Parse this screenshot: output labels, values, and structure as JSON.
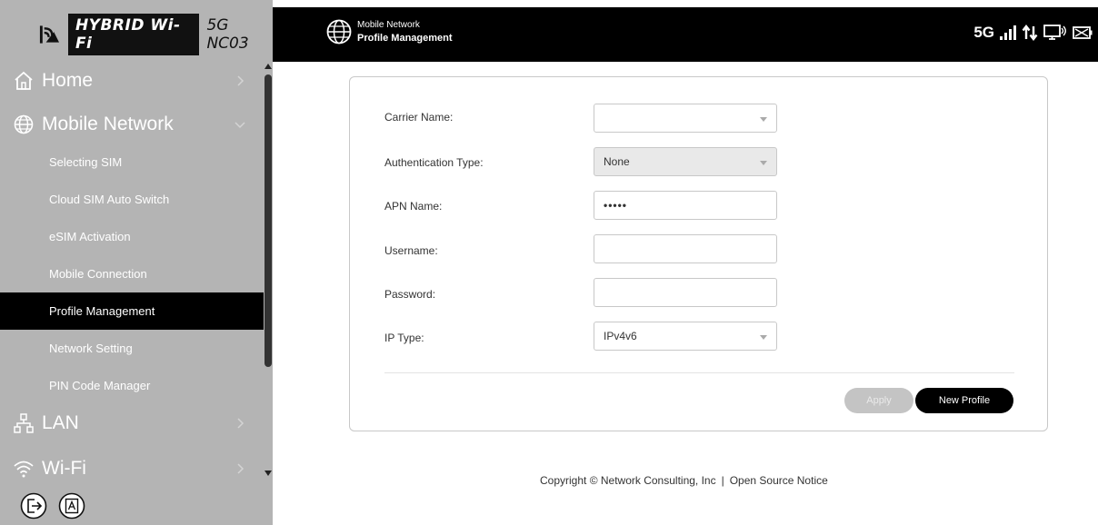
{
  "brand": {
    "logo_text": "HYBRID Wi-Fi",
    "model": "5G NC03"
  },
  "header": {
    "parent": "Mobile Network",
    "title": "Profile Management",
    "network": "5G"
  },
  "sidebar": {
    "items": [
      {
        "label": "Home"
      },
      {
        "label": "Mobile Network"
      },
      {
        "label": "Selecting SIM"
      },
      {
        "label": "Cloud SIM Auto Switch"
      },
      {
        "label": "eSIM Activation"
      },
      {
        "label": "Mobile Connection"
      },
      {
        "label": "Profile Management"
      },
      {
        "label": "Network Setting"
      },
      {
        "label": "PIN Code Manager"
      },
      {
        "label": "LAN"
      },
      {
        "label": "Wi-Fi"
      }
    ]
  },
  "form": {
    "carrier_label": "Carrier Name:",
    "carrier_value": "",
    "auth_label": "Authentication Type:",
    "auth_value": "None",
    "apn_label": "APN Name:",
    "apn_value": "•••••",
    "username_label": "Username:",
    "username_value": "",
    "password_label": "Password:",
    "password_value": "",
    "ip_label": "IP Type:",
    "ip_value": "IPv4v6",
    "apply_label": "Apply",
    "new_profile_label": "New Profile"
  },
  "footer": {
    "copyright": "Copyright © Network Consulting, Inc",
    "separator": "|",
    "open_source": "Open Source Notice"
  },
  "colors": {
    "sidebar_bg": "#b4b4b4",
    "header_bg": "#000000",
    "active_item_bg": "#000000",
    "apply_disabled": "#c4c4c4"
  }
}
